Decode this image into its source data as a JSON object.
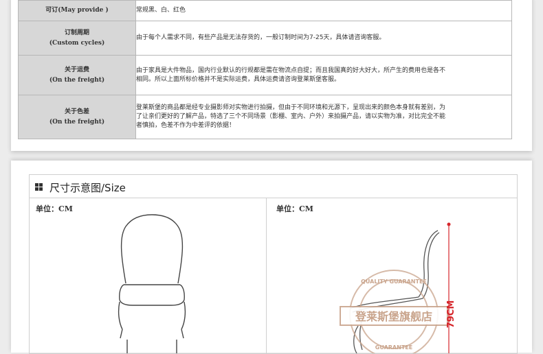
{
  "info_table": {
    "rows": [
      {
        "label_cn": "可订",
        "label_en": "(May provide )",
        "lines": [
          "常规黑、白、红色"
        ]
      },
      {
        "label_cn": "订制周期",
        "label_en": "(Custom cycles)",
        "lines": [
          "由于每个人需求不同，有些产品是无法存货的，一般订制时间为7-25天，具体请咨询客服。"
        ]
      },
      {
        "label_cn": "关于运费",
        "label_en": "(On the freight)",
        "lines": [
          "由于家具是大件物品，国内行业默认的行规都是需在物流点自提；而且我国真的好大好大，所产生的费用也是各不",
          "相同。所以上面所标价格并不是实际运费，具体运费请咨询登莱斯堡客服。"
        ]
      },
      {
        "label_cn": "关于色差",
        "label_en": "(On the freight)",
        "lines": [
          "登莱斯堡的商品都是经专业摄影师对实物进行拍摄，但由于不同环境和光源下，呈现出来的颜色本身就有差别，为",
          "了让亲们更好的了解产品，特选了三个不同场景（影棚、室内、户外）来拍摄产品，请以实物为准，对比完全不能",
          "者慎拍，色差不作为中差评的依据！"
        ]
      }
    ]
  },
  "size_section": {
    "title": "尺寸示意图/Size",
    "left_unit": "单位：CM",
    "right_unit": "单位：CM",
    "height_label": "79CM",
    "watermark_text": "登莱斯堡旗舰店",
    "watermark_ring_top": "QUALITY GUARANTEE",
    "watermark_ring_bottom": "GUARANTEE"
  },
  "colors": {
    "dimension_red": "#d6262b",
    "watermark": "#c9a48c",
    "label_bg": "#d7d7d7"
  }
}
